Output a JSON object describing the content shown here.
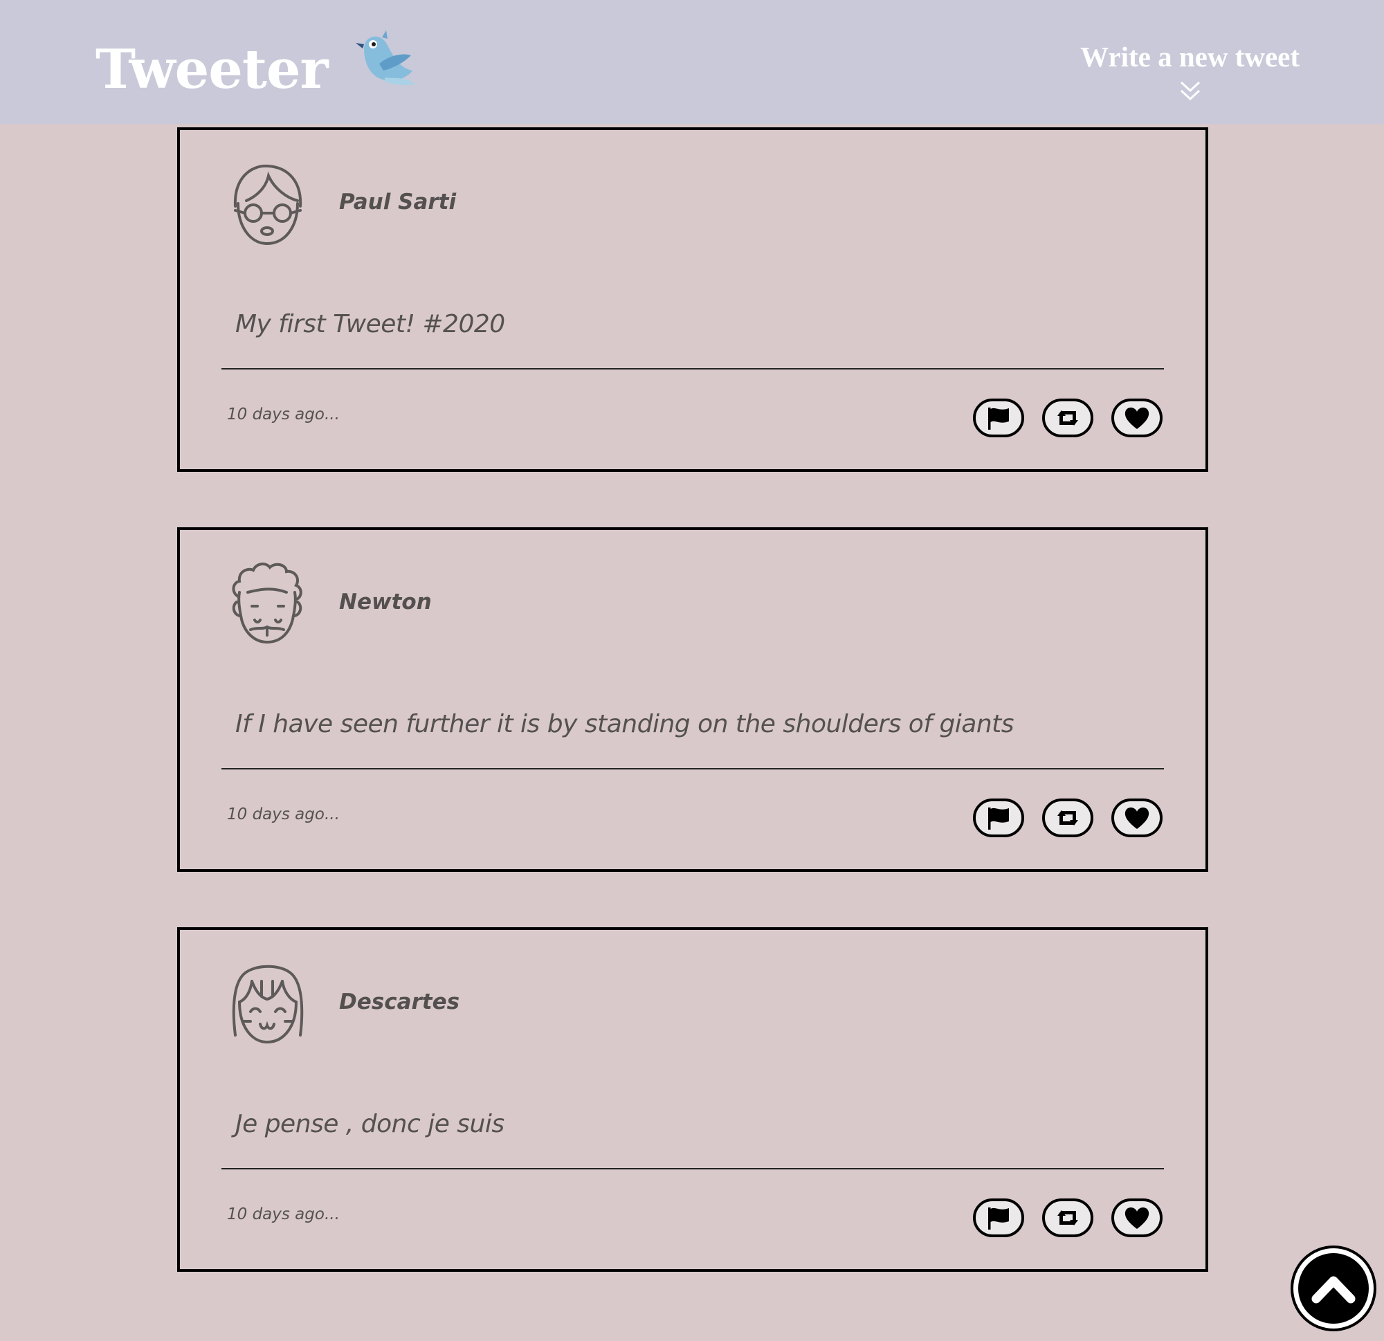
{
  "header": {
    "brand_title": "Tweeter",
    "brand_icon": "bird-logo-icon",
    "compose_label": "Write a new tweet",
    "compose_icon": "double-chevron-down-icon"
  },
  "tweets": [
    {
      "author": "Paul Sarti",
      "avatar": "face-glasses-avatar",
      "text": "My first Tweet! #2020",
      "time": "10 days ago..."
    },
    {
      "author": "Newton",
      "avatar": "face-curly-hair-avatar",
      "text": "If I have seen further it is by standing on the shoulders of giants",
      "time": "10 days ago..."
    },
    {
      "author": "Descartes",
      "avatar": "face-bangs-avatar",
      "text": "Je pense , donc je suis",
      "time": "10 days ago..."
    }
  ],
  "actions": [
    "flag-icon",
    "retweet-icon",
    "heart-icon"
  ],
  "scroll_top_icon": "chevron-up-icon",
  "colors": {
    "page_background": "#d9c9ca",
    "header_background": "#c9c9d9",
    "header_text": "#ffffff",
    "tweet_border": "#000000",
    "muted_text": "#555151",
    "bird_blue": "#86bddc"
  }
}
